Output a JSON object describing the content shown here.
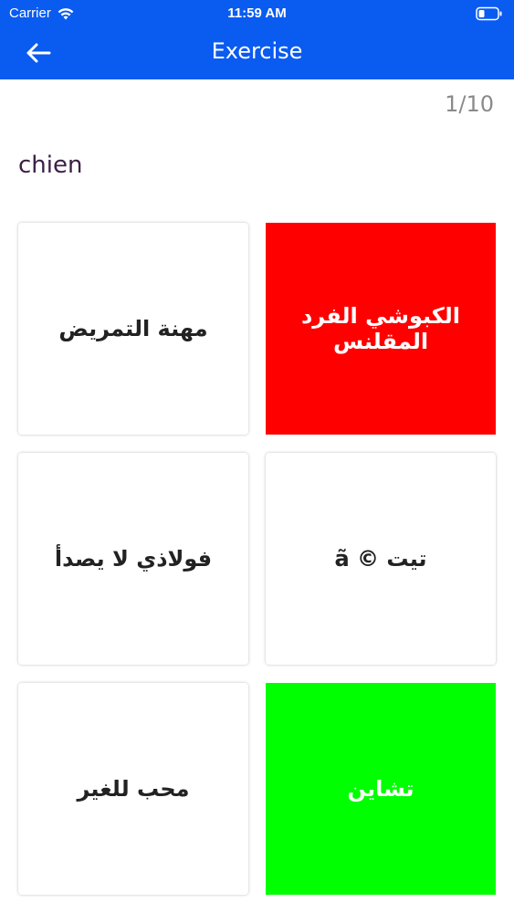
{
  "status_bar": {
    "carrier": "Carrier",
    "time": "11:59 AM",
    "wifi_icon": "wifi-icon",
    "battery_icon": "battery-icon"
  },
  "nav": {
    "title": "Exercise",
    "back_icon": "arrow-left-icon"
  },
  "exercise": {
    "progress": "1/10",
    "question": "chien"
  },
  "options": [
    {
      "text": "مهنة التمريض",
      "state": "default"
    },
    {
      "text": "الكبوشي الفرد المقلنس",
      "state": "incorrect"
    },
    {
      "text": "فولاذي لا يصدأ",
      "state": "default"
    },
    {
      "text": "تيت © ã",
      "state": "default"
    },
    {
      "text": "محب للغير",
      "state": "default"
    },
    {
      "text": "تشاين",
      "state": "correct"
    }
  ],
  "colors": {
    "header": "#0a5bf0",
    "incorrect": "#ff0000",
    "correct": "#00ff00",
    "question_text": "#3b2146",
    "progress_text": "#8a8a8a"
  }
}
